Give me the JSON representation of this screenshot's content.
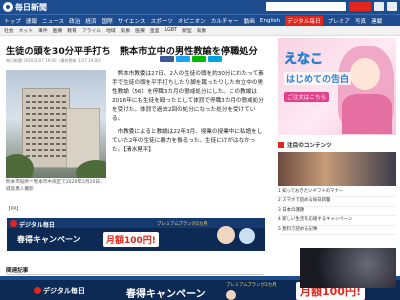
{
  "header": {
    "logo_text": "毎日新聞",
    "nav_items": [
      "トップ",
      "速報",
      "ニュース",
      "政治",
      "経済",
      "国際",
      "サイエンス",
      "スポーツ",
      "オピニオン",
      "カルチャー",
      "動画",
      "English",
      "デジタル毎日",
      "プレミア",
      "写真",
      "連載"
    ],
    "nav_highlight": "デジタル毎日",
    "subnav_items": [
      "社会",
      "ネット",
      "事件",
      "医療",
      "教育",
      "アライル",
      "地域",
      "気象",
      "医療",
      "皇室",
      "LGBT",
      "新型",
      "気象"
    ]
  },
  "article": {
    "headline": "生徒の頭を30分平手打ち　熊本市立中の男性教諭を停職処分",
    "meta": "毎日新聞 2020/3/27 19:00（最終更新 3/27 19:00）",
    "paragraphs": [
      "熊本市教委は27日、2人の生徒の頭を約30分にわたって素手で生徒の頭を平手打ちしたり脚を蹴ったりした市立中の男性教諭（56）を停職3カ月の懲戒処分にした。この教諭は2016年にも生徒を殴ったとして体罰で停職3カ月の懲戒処分を受けた。体罰で過去2回の処分になった処分を受けている。",
      "市教委によると教諭は22年3月、授業の授業中に私語をしていた2年の生徒に暴力を振るった。生徒にけがはなかった。【清水晃平】"
    ],
    "photo_caption": "熊本市役所＝熊本市中央区で2020年2月20日、城島勇人撮影",
    "pr_label": "【PR】",
    "related_heading": "関連記事"
  },
  "ads": {
    "mid": {
      "brand": "デジタル毎日",
      "note": "プレミアムプランが2カ月",
      "campaign": "春得キャンペーン",
      "price": "月額100円!"
    },
    "bottom": {
      "brand": "デジタル毎日",
      "campaign": "春得キャンペーン",
      "note": "プレミアムプランが2カ月",
      "price": "月額100円!"
    },
    "side": {
      "title": "えなこ",
      "subtitle": "はじめての告白",
      "pill": "ご注文はこちら"
    }
  },
  "sidebar": {
    "section_title": "注目のコンテンツ",
    "rows": [
      "1 知っておきたいギフトのマナー",
      "2 スマホで読める毎日新聞",
      "3 日本の課題",
      "4 新しい生活を応援するキャンペーン",
      "5 無料で読める記事"
    ]
  },
  "colors": {
    "brand_blue": "#1d4c8f",
    "accent_red": "#e2261c",
    "ad_navy": "#0d2a55"
  }
}
